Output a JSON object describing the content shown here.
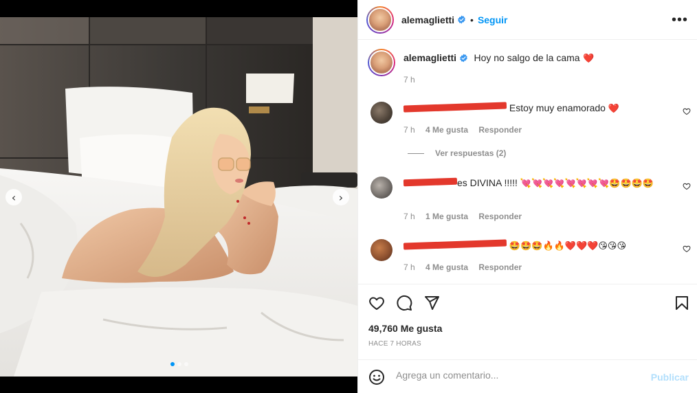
{
  "post": {
    "username": "alemaglietti",
    "follow_label": "Seguir",
    "bullet": "•",
    "more_icon": "more-horizontal-icon"
  },
  "caption": {
    "username": "alemaglietti",
    "text": "Hoy no salgo de la cama",
    "emoji": "❤️",
    "time": "7 h"
  },
  "comments": [
    {
      "text": "Estoy muy enamorado",
      "emoji": "❤️",
      "time": "7 h",
      "likes": "4 Me gusta",
      "reply_label": "Responder"
    },
    {
      "text": "es DIVINA !!!!!",
      "emoji": "💘💘💘💘💘💘💘💘🤩🤩🤩🤩",
      "time": "7 h",
      "likes": "1 Me gusta",
      "reply_label": "Responder"
    },
    {
      "text": "",
      "emoji": "🤩🤩🤩🔥🔥❤️❤️❤️😘😘😘",
      "time": "7 h",
      "likes": "4 Me gusta",
      "reply_label": "Responder"
    }
  ],
  "view_replies": "Ver respuestas (2)",
  "stats": {
    "likes": "49,760 Me gusta",
    "time_ago": "HACE 7 HORAS"
  },
  "comment_box": {
    "placeholder": "Agrega un comentario...",
    "publish_label": "Publicar"
  },
  "colors": {
    "accent": "#0095f6",
    "text": "#262626",
    "muted": "#8e8e8e",
    "heart": "#ed1c24",
    "publish_disabled": "#b2dffc"
  },
  "carousel": {
    "slides": 3,
    "active": 1
  }
}
